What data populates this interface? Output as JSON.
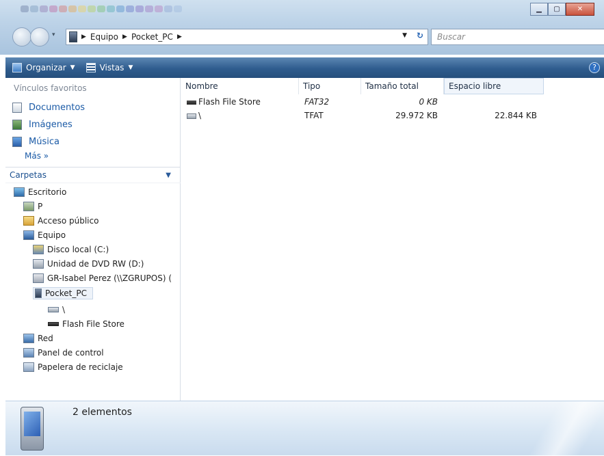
{
  "window": {
    "controls": [
      "minimize",
      "maximize",
      "close"
    ]
  },
  "address_bar": {
    "segments": [
      "Equipo",
      "Pocket_PC"
    ],
    "device_icon": "pocket-pc-icon"
  },
  "search": {
    "placeholder": "Buscar"
  },
  "toolbar": {
    "organize": "Organizar",
    "views": "Vistas"
  },
  "favorites": {
    "title": "Vínculos favoritos",
    "items": [
      {
        "label": "Documentos",
        "icon": "documents-icon"
      },
      {
        "label": "Imágenes",
        "icon": "pictures-icon"
      },
      {
        "label": "Música",
        "icon": "music-icon"
      }
    ],
    "more": "Más »"
  },
  "folders": {
    "title": "Carpetas",
    "tree": [
      {
        "label": "Escritorio",
        "icon": "desktop-icon"
      },
      {
        "label": "P",
        "icon": "user-folder-icon"
      },
      {
        "label": "Acceso público",
        "icon": "folder-icon"
      },
      {
        "label": "Equipo",
        "icon": "computer-icon"
      },
      {
        "label": "Disco local (C:)",
        "icon": "drive-icon"
      },
      {
        "label": "Unidad de DVD RW (D:)",
        "icon": "dvd-drive-icon"
      },
      {
        "label": "GR-Isabel Perez (\\\\ZGRUPOS) (",
        "icon": "network-drive-disconnected-icon"
      },
      {
        "label": "Pocket_PC",
        "icon": "pocket-pc-icon"
      },
      {
        "label": "\\",
        "icon": "removable-drive-icon"
      },
      {
        "label": "Flash File Store",
        "icon": "flash-store-icon"
      },
      {
        "label": "Red",
        "icon": "network-icon"
      },
      {
        "label": "Panel de control",
        "icon": "control-panel-icon"
      },
      {
        "label": "Papelera de reciclaje",
        "icon": "recycle-bin-icon"
      }
    ]
  },
  "table": {
    "columns": [
      "Nombre",
      "Tipo",
      "Tamaño total",
      "Espacio libre"
    ],
    "rows": [
      {
        "name": "Flash File Store",
        "type": "FAT32",
        "total": "0 KB",
        "free": ""
      },
      {
        "name": "\\",
        "type": "TFAT",
        "total": "29.972 KB",
        "free": "22.844 KB"
      }
    ]
  },
  "status": {
    "count": "2 elementos"
  },
  "colors": {
    "toolbar": "#2f5c8e",
    "link": "#1a5aa6",
    "accent": "#2a67b5"
  }
}
